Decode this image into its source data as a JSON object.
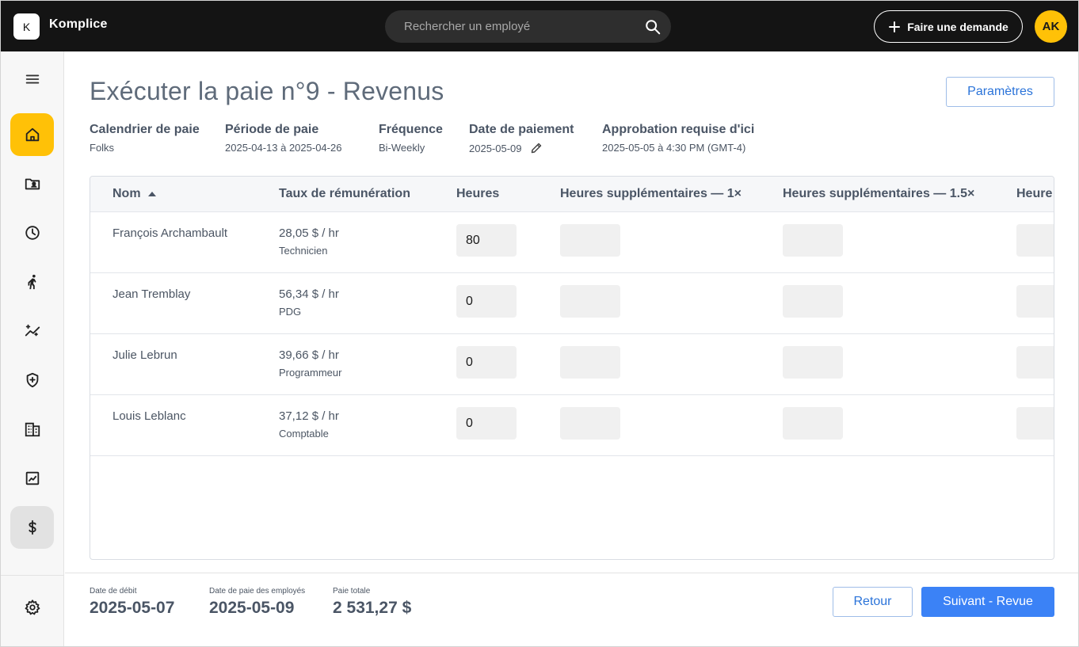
{
  "app": {
    "logo_letter": "K",
    "name": "Komplice"
  },
  "search": {
    "placeholder": "Rechercher un employé",
    "value": ""
  },
  "header": {
    "request_button": "Faire une demande",
    "avatar_initials": "AK"
  },
  "sidebar": {
    "items": [
      {
        "id": "menu",
        "icon": "menu-icon"
      },
      {
        "id": "home",
        "icon": "home-icon",
        "state": "active"
      },
      {
        "id": "employees",
        "icon": "folder-person-icon"
      },
      {
        "id": "time",
        "icon": "clock-icon"
      },
      {
        "id": "activities",
        "icon": "person-walking-icon"
      },
      {
        "id": "performance",
        "icon": "sparkle-chart-icon"
      },
      {
        "id": "benefits",
        "icon": "shield-plus-icon"
      },
      {
        "id": "company",
        "icon": "building-icon"
      },
      {
        "id": "reports",
        "icon": "line-chart-icon"
      },
      {
        "id": "payroll",
        "icon": "dollar-icon",
        "state": "current"
      },
      {
        "id": "settings",
        "icon": "gear-icon"
      }
    ]
  },
  "page": {
    "title": "Exécuter la paie n°9 - Revenus",
    "settings_button": "Paramètres"
  },
  "info": {
    "calendar": {
      "label": "Calendrier de paie",
      "value": "Folks"
    },
    "period": {
      "label": "Période de paie",
      "value": "2025-04-13 à 2025-04-26"
    },
    "frequency": {
      "label": "Fréquence",
      "value": "Bi-Weekly"
    },
    "payment_date": {
      "label": "Date de paiement",
      "value": "2025-05-09"
    },
    "approval": {
      "label": "Approbation requise d'ici",
      "value": "2025-05-05 à 4:30 PM (GMT-4)"
    }
  },
  "table": {
    "headers": {
      "name": "Nom",
      "rate": "Taux de rémunération",
      "hours": "Heures",
      "ot1": "Heures supplémentaires — 1×",
      "ot15": "Heures supplémentaires — 1.5×",
      "ot_next": "Heure"
    },
    "sort": {
      "column": "name",
      "direction": "ascending"
    },
    "rows": [
      {
        "name": "François Archambault",
        "rate": "28,05 $ / hr",
        "role": "Technicien",
        "hours": "80"
      },
      {
        "name": "Jean Tremblay",
        "rate": "56,34 $ / hr",
        "role": "PDG",
        "hours": "0"
      },
      {
        "name": "Julie Lebrun",
        "rate": "39,66 $ / hr",
        "role": "Programmeur",
        "hours": "0"
      },
      {
        "name": "Louis Leblanc",
        "rate": "37,12 $ / hr",
        "role": "Comptable",
        "hours": "0"
      }
    ]
  },
  "footer": {
    "debit_date": {
      "label": "Date de débit",
      "value": "2025-05-07"
    },
    "employee_pay_date": {
      "label": "Date de paie des employés",
      "value": "2025-05-09"
    },
    "total_pay": {
      "label": "Paie totale",
      "value": "2 531,27 $"
    },
    "back_button": "Retour",
    "next_button": "Suivant - Revue"
  },
  "colors": {
    "accent": "#ffc107",
    "primary": "#3b82f6",
    "topbar": "#141414"
  }
}
